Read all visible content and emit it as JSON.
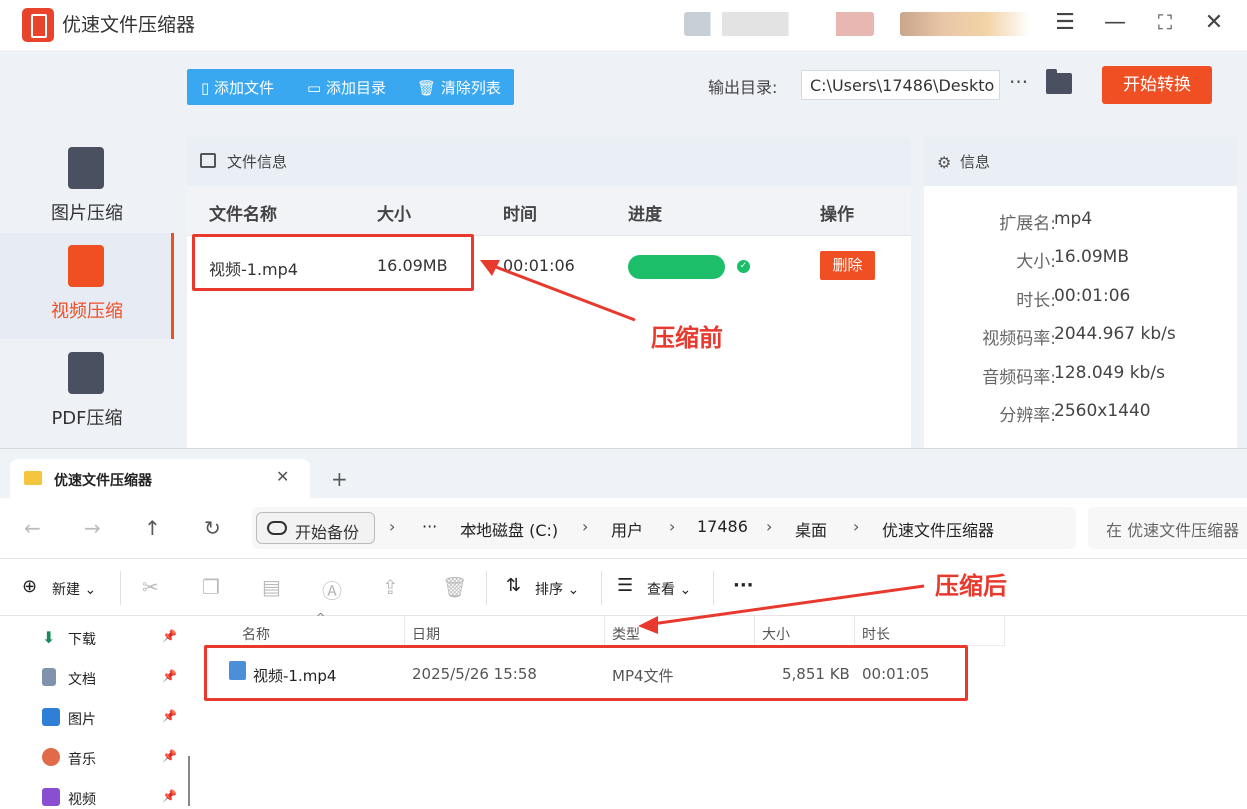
{
  "app": {
    "title": "优速文件压缩器",
    "sidebar": [
      {
        "label": "图片压缩",
        "icon": "image-file-icon"
      },
      {
        "label": "视频压缩",
        "icon": "video-file-icon",
        "active": true
      },
      {
        "label": "PDF压缩",
        "icon": "pdf-file-icon"
      }
    ],
    "toolbar": {
      "add_file": "添加文件",
      "add_dir": "添加目录",
      "clear_list": "清除列表"
    },
    "output": {
      "label": "输出目录:",
      "path": "C:\\Users\\17486\\Deskto",
      "more": "···"
    },
    "start_label": "开始转换",
    "file_panel": {
      "title": "文件信息",
      "columns": [
        "文件名称",
        "大小",
        "时间",
        "进度",
        "操作"
      ],
      "rows": [
        {
          "name": "视频-1.mp4",
          "size": "16.09MB",
          "time": "00:01:06",
          "progress": 1.0,
          "action": "删除"
        }
      ]
    },
    "info_panel": {
      "title": "信息",
      "rows": [
        {
          "k": "扩展名:",
          "v": "mp4"
        },
        {
          "k": "大小:",
          "v": "16.09MB"
        },
        {
          "k": "时长:",
          "v": "00:01:06"
        },
        {
          "k": "视频码率:",
          "v": "2044.967 kb/s"
        },
        {
          "k": "音频码率:",
          "v": "128.049 kb/s"
        },
        {
          "k": "分辨率:",
          "v": "2560x1440"
        }
      ]
    },
    "colors": {
      "accent": "#f04e23",
      "toolbar": "#39a8f0",
      "progress": "#1dbe6a"
    }
  },
  "annotations": {
    "before": "压缩前",
    "after": "压缩后"
  },
  "explorer": {
    "tab_title": "优速文件压缩器",
    "backup_label": "开始备份",
    "breadcrumb": [
      "本地磁盘 (C:)",
      "用户",
      "17486",
      "桌面",
      "优速文件压缩器"
    ],
    "search_placeholder": "在 优速文件压缩器",
    "commands": {
      "new": "新建",
      "sort": "排序",
      "view": "查看",
      "more": "···"
    },
    "nav_items": [
      "下载",
      "文档",
      "图片",
      "音乐",
      "视频"
    ],
    "columns": [
      "名称",
      "日期",
      "类型",
      "大小",
      "时长"
    ],
    "rows": [
      {
        "name": "视频-1.mp4",
        "date": "2025/5/26 15:58",
        "type": "MP4文件",
        "size": "5,851 KB",
        "duration": "00:01:05"
      }
    ]
  }
}
